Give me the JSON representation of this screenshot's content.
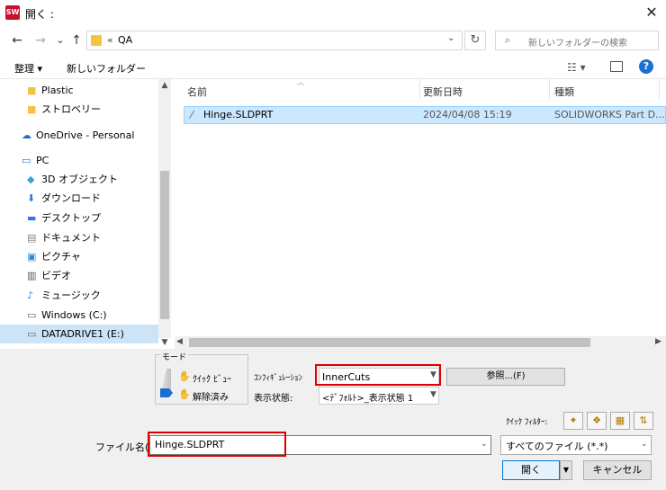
{
  "title": "開く :",
  "app_icon_text": "SW",
  "nav": {
    "back": "←",
    "forward": "→",
    "recent": "⌄",
    "up": "↑",
    "breadcrumb_sep": "«",
    "breadcrumb": "QA",
    "refresh": "↻",
    "search_placeholder": "新しいフォルダーの検索"
  },
  "commands": {
    "organize": "整理 ▾",
    "new_folder": "新しいフォルダー"
  },
  "sidebar": [
    {
      "label": "Plastic",
      "icon": "folder-icon",
      "indent": 1
    },
    {
      "label": "ストロベリー",
      "icon": "folder-icon",
      "indent": 1
    },
    {
      "label": "OneDrive - Personal",
      "icon": "cloud-icon",
      "indent": 0
    },
    {
      "label": "PC",
      "icon": "pc-icon",
      "indent": 0
    },
    {
      "label": "3D オブジェクト",
      "icon": "cube-icon",
      "indent": 1
    },
    {
      "label": "ダウンロード",
      "icon": "download-icon",
      "indent": 1
    },
    {
      "label": "デスクトップ",
      "icon": "desktop-icon",
      "indent": 1
    },
    {
      "label": "ドキュメント",
      "icon": "document-icon",
      "indent": 1
    },
    {
      "label": "ピクチャ",
      "icon": "picture-icon",
      "indent": 1
    },
    {
      "label": "ビデオ",
      "icon": "video-icon",
      "indent": 1
    },
    {
      "label": "ミュージック",
      "icon": "music-icon",
      "indent": 1
    },
    {
      "label": "Windows (C:)",
      "icon": "drive-icon",
      "indent": 1
    },
    {
      "label": "DATADRIVE1 (E:)",
      "icon": "drive-icon",
      "indent": 1
    }
  ],
  "columns": {
    "name": "名前",
    "modified": "更新日時",
    "type": "種類"
  },
  "files": [
    {
      "name": "Hinge.SLDPRT",
      "modified": "2024/04/08 15:19",
      "type": "SOLIDWORKS Part D..."
    }
  ],
  "mode": {
    "label": "モード",
    "quick_view": "ｸｲｯｸ ﾋﾞｭｰ",
    "resolved": "解除済み"
  },
  "config": {
    "label": "ｺﾝﾌｨｷﾞｭﾚｰｼｮﾝ",
    "value": "InnerCuts",
    "browse": "参照...(F)",
    "display_state_label": "表示状態:",
    "display_state_value": "<ﾃﾞﾌｫﾙﾄ>_表示状態 1"
  },
  "quick_filter_label": "ｸｲｯｸ ﾌｨﾙﾀｰ:",
  "filename": {
    "label": "ファイル名(N):",
    "value": "Hinge.SLDPRT"
  },
  "filetype": {
    "value": "すべてのファイル (*.*)"
  },
  "buttons": {
    "open": "開く",
    "cancel": "キャンセル"
  },
  "colors": {
    "accent": "#0078d7",
    "highlight": "#e00000",
    "selection": "#cce8ff"
  }
}
